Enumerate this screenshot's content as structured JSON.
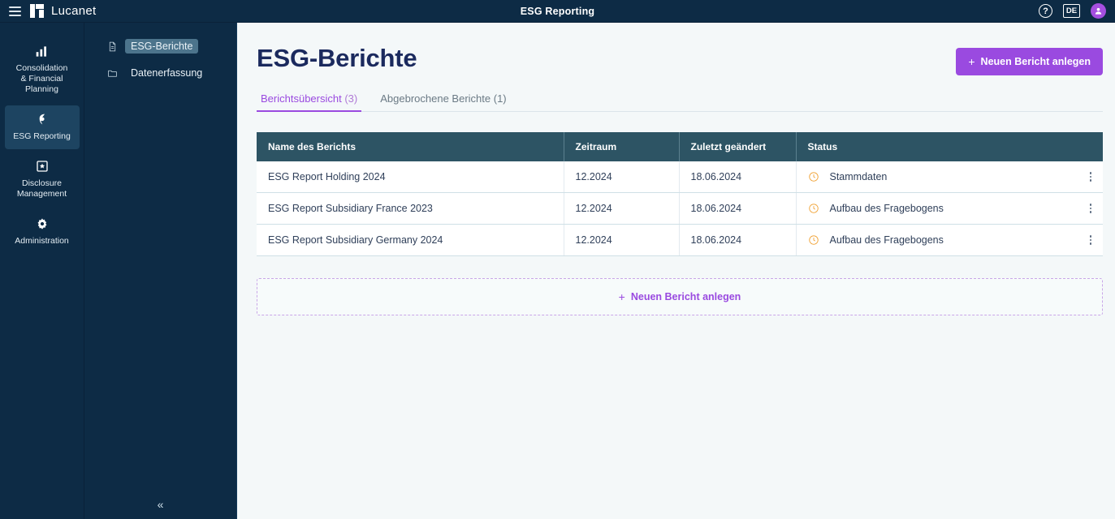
{
  "topbar": {
    "menu_icon": "hamburger-icon",
    "brand": "Lucanet",
    "title": "ESG Reporting",
    "help_icon": "?",
    "language": "DE",
    "avatar_icon": "user-avatar-icon"
  },
  "rail": {
    "items": [
      {
        "label": "Consolidation\n& Financial\nPlanning",
        "line1": "Consolidation",
        "line2": "& Financial",
        "line3": "Planning",
        "icon": "bar-chart-icon",
        "active": false
      },
      {
        "label": "ESG Reporting",
        "line1": "ESG Reporting",
        "line2": "",
        "line3": "",
        "icon": "leaf-icon",
        "active": true
      },
      {
        "label": "Disclosure Management",
        "line1": "Disclosure",
        "line2": "Management",
        "line3": "",
        "icon": "document-star-icon",
        "active": false
      },
      {
        "label": "Administration",
        "line1": "Administration",
        "line2": "",
        "line3": "",
        "icon": "gear-icon",
        "active": false
      }
    ]
  },
  "tree": {
    "items": [
      {
        "label": "ESG-Berichte",
        "icon": "file-icon",
        "selected": true
      },
      {
        "label": "Datenerfassung",
        "icon": "folder-icon",
        "selected": false
      }
    ],
    "collapse_icon": "«"
  },
  "page": {
    "title": "ESG-Berichte",
    "primary_button": {
      "label": "Neuen Bericht anlegen",
      "plus": "+"
    },
    "tabs": [
      {
        "label": "Berichtsübersicht",
        "count": "(3)",
        "active": true
      },
      {
        "label": "Abgebrochene Berichte",
        "count": "(1)",
        "active": false
      }
    ]
  },
  "table": {
    "columns": [
      "Name des Berichts",
      "Zeitraum",
      "Zuletzt geändert",
      "Status"
    ],
    "rows": [
      {
        "name": "ESG Report Holding 2024",
        "period": "12.2024",
        "modified": "18.06.2024",
        "status": "Stammdaten",
        "status_icon": "clock-icon",
        "menu_icon": "kebab-menu-icon"
      },
      {
        "name": "ESG Report Subsidiary France 2023",
        "period": "12.2024",
        "modified": "18.06.2024",
        "status": "Aufbau des Fragebogens",
        "status_icon": "clock-icon",
        "menu_icon": "kebab-menu-icon"
      },
      {
        "name": "ESG Report Subsidiary Germany 2024",
        "period": "12.2024",
        "modified": "18.06.2024",
        "status": "Aufbau des Fragebogens",
        "status_icon": "clock-icon",
        "menu_icon": "kebab-menu-icon"
      }
    ]
  },
  "add_button": {
    "label": "Neuen Bericht anlegen",
    "plus": "+"
  },
  "colors": {
    "navy": "#0d2b45",
    "rail_active": "#1d4461",
    "purple": "#9a4ae0",
    "table_header": "#2d5464",
    "status_orange": "#f0a030",
    "title_navy": "#1b2a5e",
    "content_bg": "#f4f8f9"
  }
}
